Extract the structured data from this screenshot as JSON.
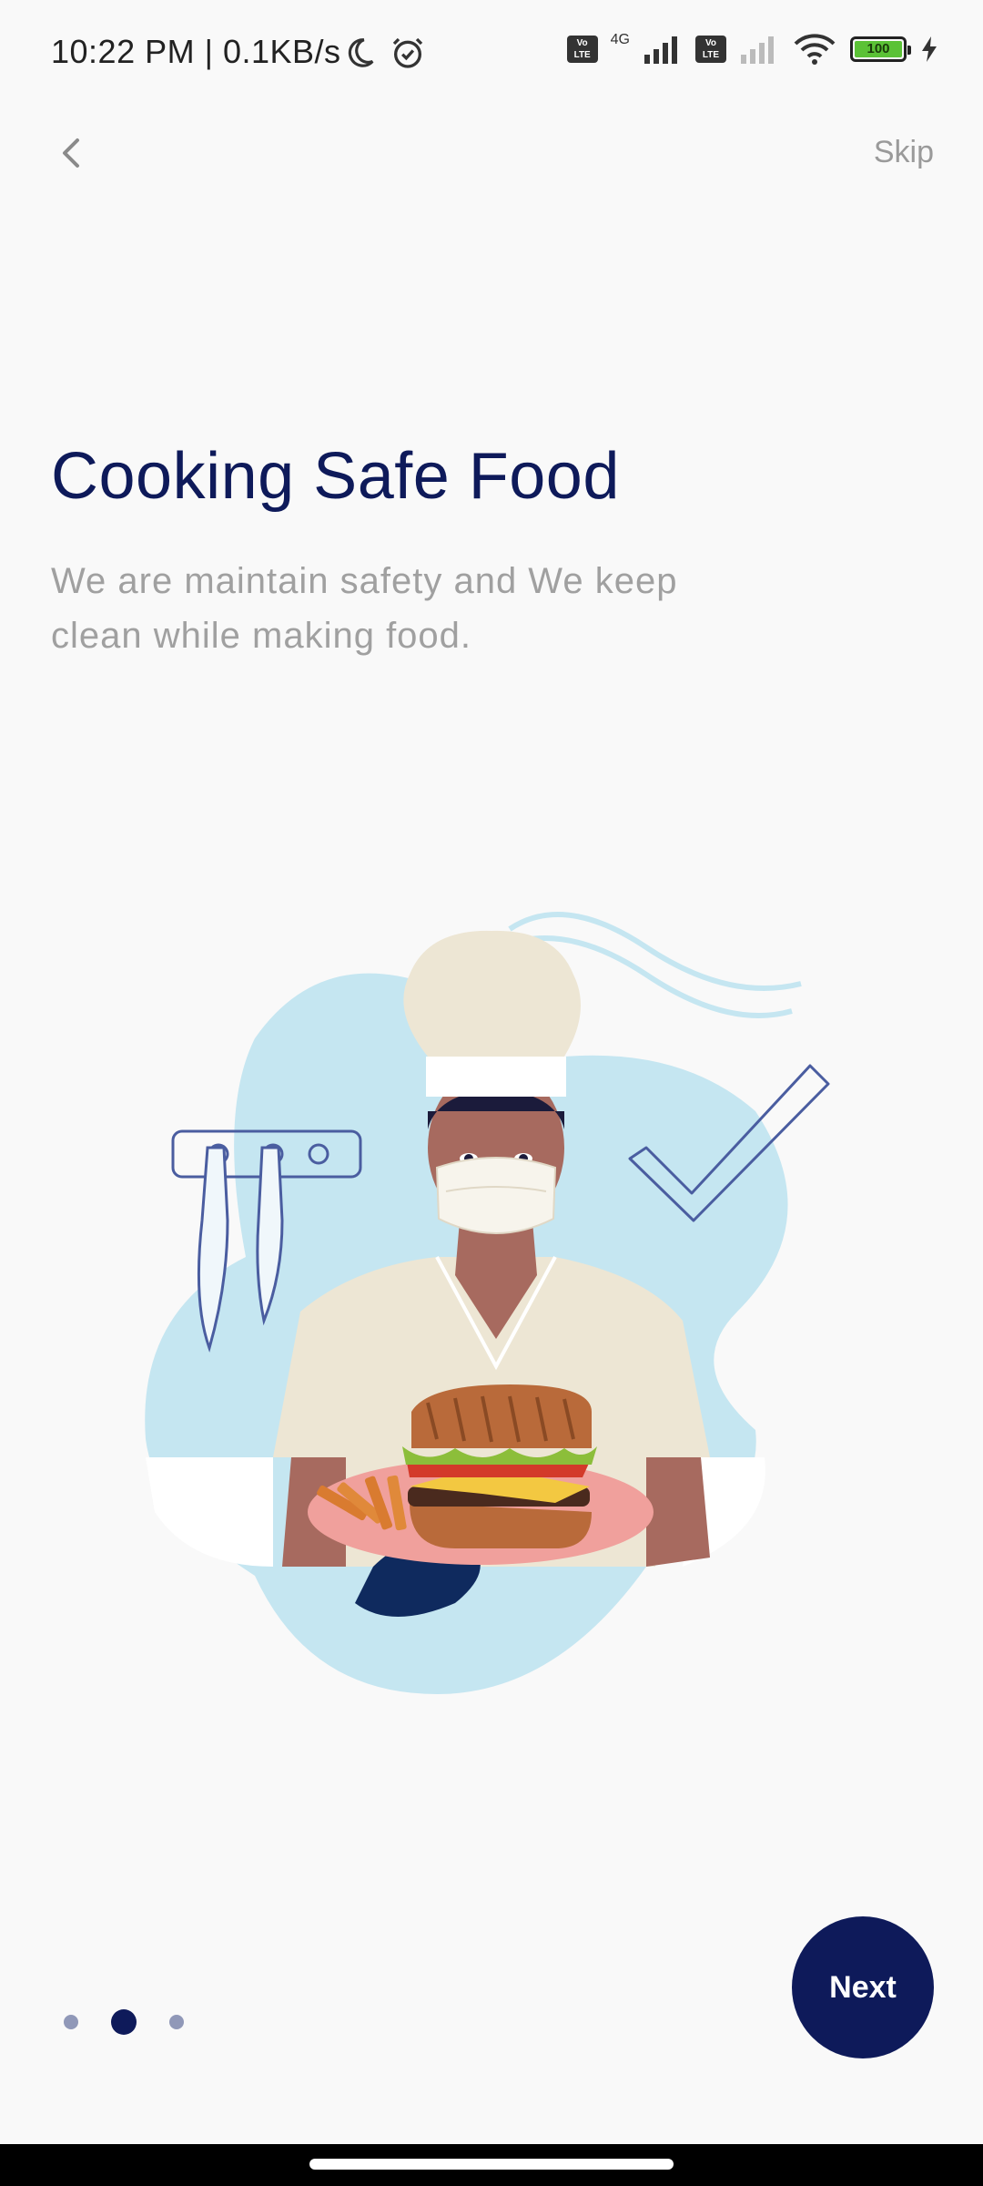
{
  "status_bar": {
    "time": "10:22 PM | 0.1KB/s",
    "network_label": "4G",
    "battery_level": "100",
    "icons": [
      "moon-icon",
      "alarm-icon",
      "volte-icon",
      "signal-icon",
      "volte-icon",
      "signal-icon",
      "wifi-icon",
      "battery-icon",
      "charging-icon"
    ]
  },
  "header": {
    "back_icon": "chevron-left-icon",
    "skip_label": "Skip"
  },
  "content": {
    "title": "Cooking Safe Food",
    "description": "We are maintain safety and We keep clean while making food."
  },
  "pager": {
    "total": 3,
    "active_index": 1
  },
  "actions": {
    "next_label": "Next"
  },
  "colors": {
    "primary": "#0e1a5a",
    "muted_text": "#a0a0a0",
    "background": "#f9f9f9",
    "accent_blob": "#c5e6f1"
  }
}
